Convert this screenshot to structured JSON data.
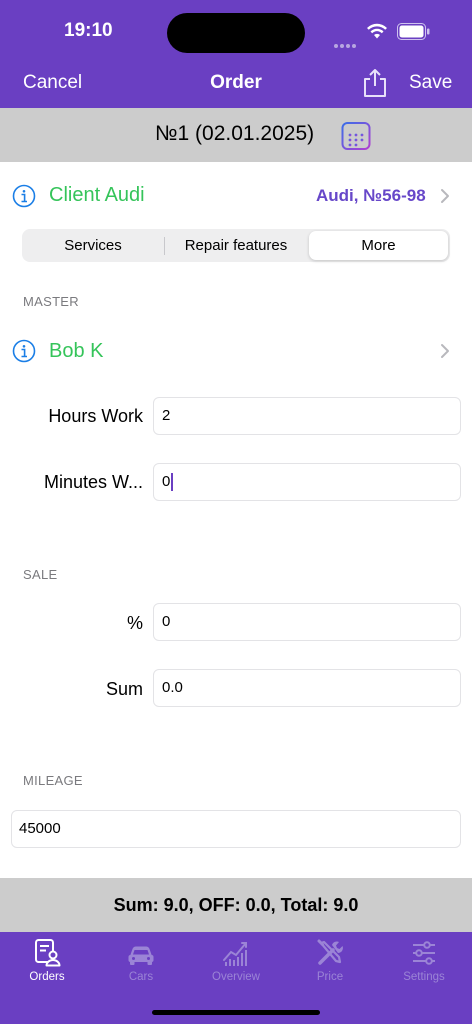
{
  "status": {
    "time": "19:10"
  },
  "nav": {
    "cancel": "Cancel",
    "title": "Order",
    "save": "Save"
  },
  "order": {
    "title": "№1 (02.01.2025)"
  },
  "client": {
    "label": "Client Audi",
    "value": "Audi, №56-98"
  },
  "segments": [
    {
      "label": "Services",
      "active": false
    },
    {
      "label": "Repair features",
      "active": false
    },
    {
      "label": "More",
      "active": true
    }
  ],
  "master": {
    "header": "MASTER",
    "name": "Bob K"
  },
  "work": {
    "hours_label": "Hours Work",
    "hours_value": "2",
    "minutes_label": "Minutes W...",
    "minutes_value": "0"
  },
  "sale": {
    "header": "SALE",
    "percent_label": "%",
    "percent_value": "0",
    "sum_label": "Sum",
    "sum_value": "0.0"
  },
  "mileage": {
    "header": "MILEAGE",
    "value": "45000"
  },
  "totals": {
    "text": "Sum: 9.0, OFF: 0.0, Total: 9.0"
  },
  "tabs": [
    {
      "label": "Orders",
      "icon": "orders-icon",
      "active": true
    },
    {
      "label": "Cars",
      "icon": "car-icon",
      "active": false
    },
    {
      "label": "Overview",
      "icon": "chart-icon",
      "active": false
    },
    {
      "label": "Price",
      "icon": "tools-icon",
      "active": false
    },
    {
      "label": "Settings",
      "icon": "sliders-icon",
      "active": false
    }
  ],
  "colors": {
    "accent": "#6a3fc2",
    "client_green": "#35c45a",
    "link_purple": "#6747c9",
    "info_blue": "#1a7ee6",
    "header_gray": "#cccccc"
  }
}
